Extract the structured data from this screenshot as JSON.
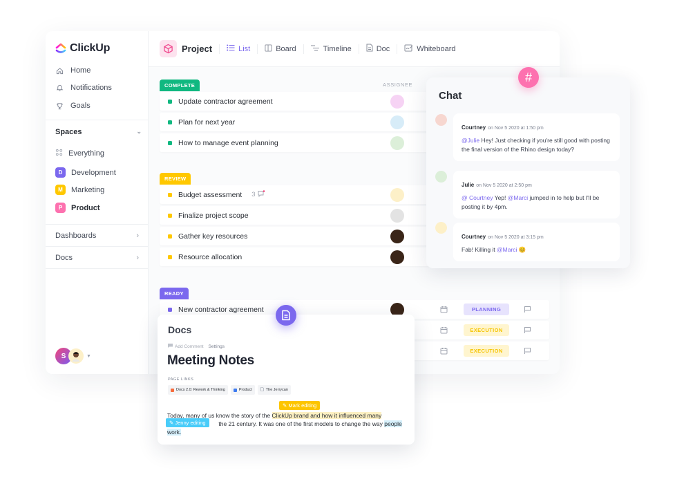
{
  "sidebar": {
    "logo": "ClickUp",
    "nav": [
      {
        "label": "Home",
        "icon": "home-icon"
      },
      {
        "label": "Notifications",
        "icon": "bell-icon"
      },
      {
        "label": "Goals",
        "icon": "trophy-icon"
      }
    ],
    "spaces_label": "Spaces",
    "spaces": [
      {
        "label": "Everything",
        "icon": "grid-dots-icon"
      },
      {
        "label": "Development",
        "letter": "D",
        "color": "#7b68ee"
      },
      {
        "label": "Marketing",
        "letter": "M",
        "color": "#ffc800"
      },
      {
        "label": "Product",
        "letter": "P",
        "color": "#fd71af"
      }
    ],
    "sections": [
      {
        "label": "Dashboards"
      },
      {
        "label": "Docs"
      }
    ],
    "user_initial": "S"
  },
  "topbar": {
    "project": "Project",
    "tabs": [
      {
        "label": "List",
        "icon": "list-icon",
        "active": true
      },
      {
        "label": "Board",
        "icon": "board-icon"
      },
      {
        "label": "Timeline",
        "icon": "timeline-icon"
      },
      {
        "label": "Doc",
        "icon": "doc-icon"
      },
      {
        "label": "Whiteboard",
        "icon": "whiteboard-icon"
      }
    ]
  },
  "list": {
    "assignee_header": "ASSIGNEE",
    "groups": [
      {
        "status": "COMPLETE",
        "color": "#10b880",
        "tasks": [
          {
            "name": "Update contractor agreement"
          },
          {
            "name": "Plan for next year"
          },
          {
            "name": "How to manage event planning"
          }
        ]
      },
      {
        "status": "REVIEW",
        "color": "#ffc800",
        "tasks": [
          {
            "name": "Budget assessment",
            "comments": "3"
          },
          {
            "name": "Finalize project scope"
          },
          {
            "name": "Gather key resources"
          },
          {
            "name": "Resource allocation"
          }
        ]
      },
      {
        "status": "READY",
        "color": "#7b68ee",
        "tasks": [
          {
            "name": "New contractor agreement",
            "stage": "PLANNING"
          },
          {
            "name": "",
            "stage": "EXECUTION"
          },
          {
            "name": "",
            "stage": "EXECUTION"
          }
        ]
      }
    ]
  },
  "chat": {
    "title": "Chat",
    "badge_icon": "#",
    "messages": [
      {
        "author": "Courtney",
        "time": "on Nov 5 2020 at 1:50 pm",
        "mention": "@Julie",
        "text": " Hey! Just checking if you're still good with posting the final version of the Rhino design today?"
      },
      {
        "author": "Julie",
        "time": "on Nov 5 2020 at 2:50 pm",
        "mention": "@ Courtney",
        "text_a": " Yep! ",
        "mention2": "@Marci",
        "text_b": " jumped in to help but I'll be posting it by 4pm."
      },
      {
        "author": "Courtney",
        "time": "on Nov 5 2020 at 3:15 pm",
        "text": "Fab! Killing it ",
        "mention": "@Marci",
        "emoji": "😊"
      }
    ]
  },
  "docs": {
    "title": "Docs",
    "add_comment": "Add Comment",
    "settings": "Settings",
    "heading": "Meeting Notes",
    "page_links_label": "PAGE LINKS",
    "page_links": [
      {
        "label": "Docs 2.0: Rework & Thinking",
        "color": "#f76b3c"
      },
      {
        "label": "Product",
        "color": "#3d7af0"
      },
      {
        "label": "The Jerrycan",
        "color": "#9aa0ac"
      }
    ],
    "mark_tag": "Mark editing",
    "jenny_tag": "Jenny editing",
    "para_a": "Today, many of us know the story of the ",
    "para_hl": "ClickUp brand and how it influenced many",
    "para_b": " the 21 century. It was one of the first models  to change the way ",
    "para_hl2": "people work."
  }
}
